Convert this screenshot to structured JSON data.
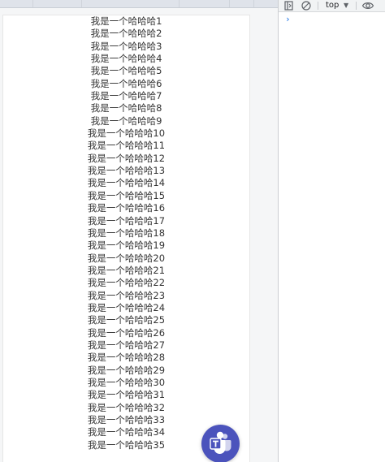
{
  "list": {
    "items": [
      "我是一个哈哈哈1",
      "我是一个哈哈哈2",
      "我是一个哈哈哈3",
      "我是一个哈哈哈4",
      "我是一个哈哈哈5",
      "我是一个哈哈哈6",
      "我是一个哈哈哈7",
      "我是一个哈哈哈8",
      "我是一个哈哈哈9",
      "我是一个哈哈哈10",
      "我是一个哈哈哈11",
      "我是一个哈哈哈12",
      "我是一个哈哈哈13",
      "我是一个哈哈哈14",
      "我是一个哈哈哈15",
      "我是一个哈哈哈16",
      "我是一个哈哈哈17",
      "我是一个哈哈哈18",
      "我是一个哈哈哈19",
      "我是一个哈哈哈20",
      "我是一个哈哈哈21",
      "我是一个哈哈哈22",
      "我是一个哈哈哈23",
      "我是一个哈哈哈24",
      "我是一个哈哈哈25",
      "我是一个哈哈哈26",
      "我是一个哈哈哈27",
      "我是一个哈哈哈28",
      "我是一个哈哈哈29",
      "我是一个哈哈哈30",
      "我是一个哈哈哈31",
      "我是一个哈哈哈32",
      "我是一个哈哈哈33",
      "我是一个哈哈哈34",
      "我是一个哈哈哈35"
    ]
  },
  "fab": {
    "icon": "teams-icon",
    "color": "#4b53bc"
  },
  "devtools": {
    "context": "top",
    "context_arrow": "▼",
    "prompt": "›",
    "icons": {
      "sidebar": "sidebar-toggle-icon",
      "clear": "clear-console-icon",
      "eye": "eye-icon"
    },
    "prompt_color": "#1a73e8"
  }
}
